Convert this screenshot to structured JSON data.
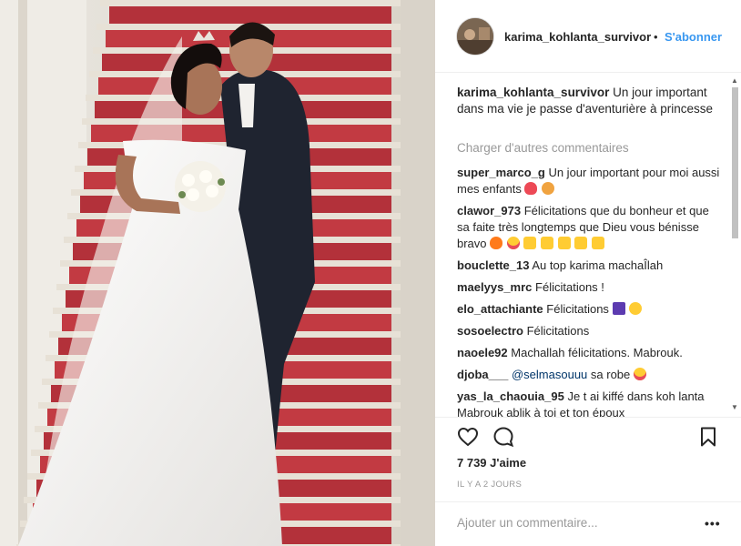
{
  "post": {
    "username": "karima_kohlanta_survivor",
    "dot": "•",
    "follow_label": "S'abonner",
    "photo_alt": "photo"
  },
  "caption": {
    "username": "karima_kohlanta_survivor",
    "text": "Un jour important dans ma vie je passe d'aventurière à princesse"
  },
  "load_more_label": "Charger d'autres commentaires",
  "comments": [
    {
      "username": "super_marco_g",
      "text": "Un jour important pour moi aussi mes enfants",
      "emoji": [
        "heart",
        "couple"
      ]
    },
    {
      "username": "clawor_973",
      "text": "Félicitations que du bonheur et que sa faite très longtemps que Dieu vous bénisse bravo",
      "emoji": [
        "fire",
        "heart-eyes",
        "thumbs-up",
        "thumbs-up",
        "thumbs-up",
        "thumbs-up",
        "thumbs-up"
      ]
    },
    {
      "username": "bouclette_13",
      "text": "Au top karima machaÎlah",
      "emoji": []
    },
    {
      "username": "maelyys_mrc",
      "text": "Félicitations !",
      "emoji": []
    },
    {
      "username": "elo_attachiante",
      "text": "Félicitations",
      "emoji": [
        "party-popper",
        "kissing-face"
      ]
    },
    {
      "username": "sosoelectro",
      "text": "Félicitations",
      "emoji": []
    },
    {
      "username": "naoele92",
      "text": "Machallah félicitations. Mabrouk.",
      "emoji": []
    },
    {
      "username": "djoba___",
      "mention": "@selmasouuu",
      "text": "sa robe",
      "emoji": [
        "heart-eyes"
      ]
    },
    {
      "username": "yas_la_chaouia_95",
      "text": "Je t ai kiffé dans koh lanta Mabrouk ablik à toi et ton époux",
      "emoji": []
    }
  ],
  "actions": {
    "like_icon": "heart-outline-icon",
    "comment_icon": "speech-bubble-icon",
    "save_icon": "bookmark-icon",
    "likes_text": "7 739 J'aime",
    "time_text": "IL Y A 2 JOURS"
  },
  "add_comment": {
    "placeholder": "Ajouter un commentaire...",
    "more_label": "•••"
  },
  "colors": {
    "link_blue": "#3897f0",
    "text": "#262626",
    "muted": "#999999",
    "heart_red": "#ed4956",
    "emoji_yellow": "#ffcc33"
  }
}
